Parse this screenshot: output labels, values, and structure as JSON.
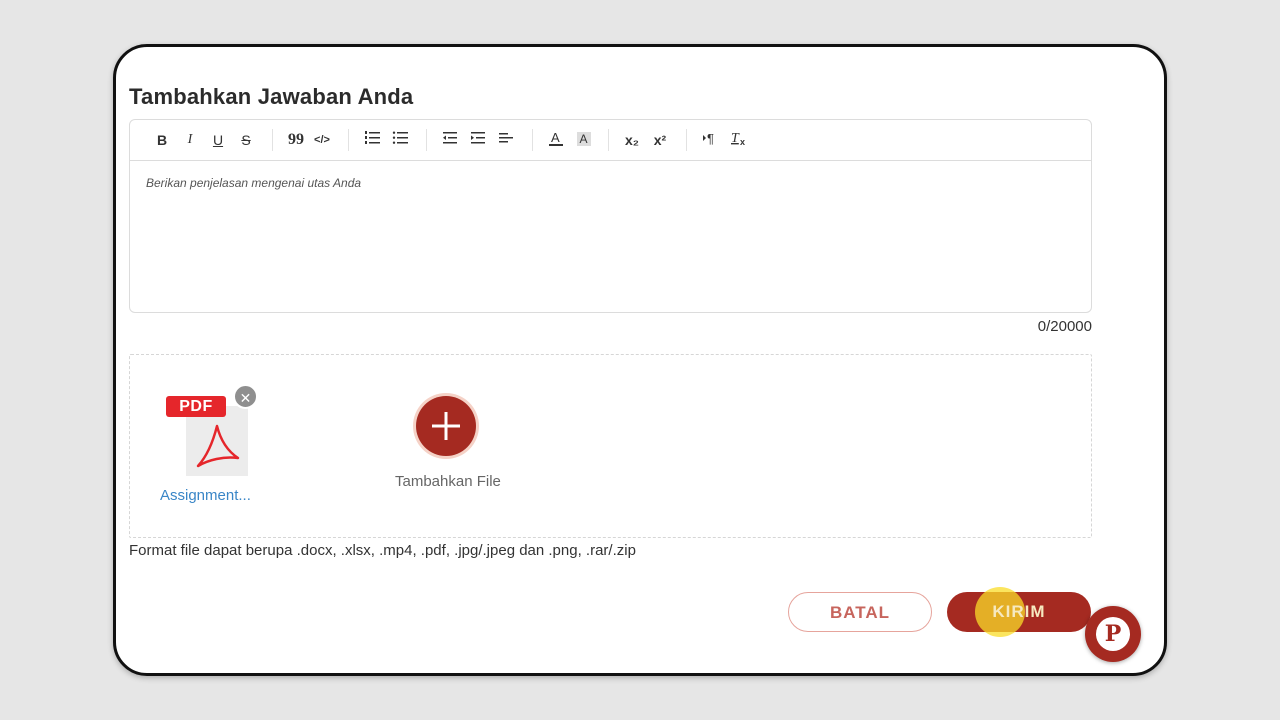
{
  "form": {
    "title": "Tambahkan Jawaban Anda",
    "editor_placeholder": "Berikan penjelasan mengenai utas Anda",
    "char_counter": "0/20000"
  },
  "toolbar": {
    "bold": "B",
    "italic": "I",
    "underline": "U",
    "strike": "S",
    "quote": "99",
    "code": "</>",
    "subscript": "x₂",
    "superscript": "x²"
  },
  "attachments": {
    "file_type_label": "PDF",
    "file_name": "Assignment...",
    "add_file_label": "Tambahkan File",
    "format_note": "Format file dapat berupa .docx, .xlsx, .mp4, .pdf, .jpg/.jpeg dan .png, .rar/.zip"
  },
  "actions": {
    "cancel_label": "BATAL",
    "send_label": "KIRIM"
  },
  "help_fab": {
    "letter": "P"
  },
  "colors": {
    "primary": "#a52a21",
    "link": "#3a86c7",
    "pdf_red": "#e5262b",
    "cancel_border": "#e6a49c"
  }
}
